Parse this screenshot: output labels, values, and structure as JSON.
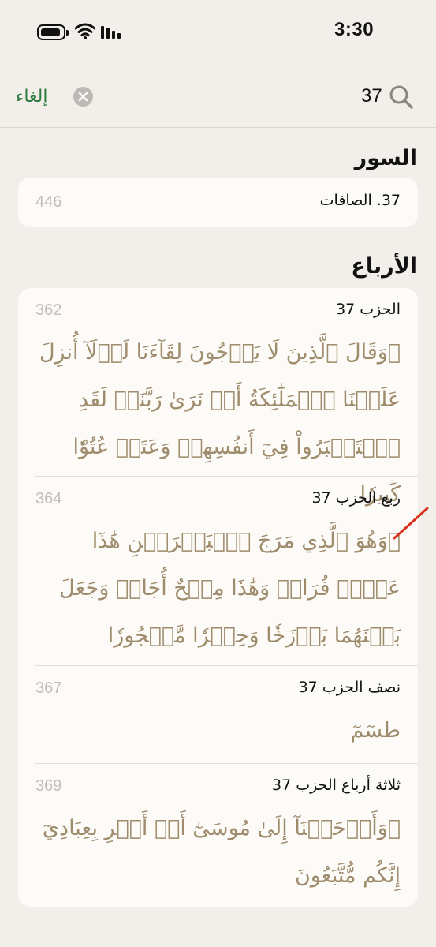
{
  "status_bar": {
    "time": "3:30"
  },
  "search": {
    "value": "37",
    "cancel_label": "إلغاء"
  },
  "sections": {
    "surahs": {
      "title": "السور",
      "items": [
        {
          "label": "37. الصافات",
          "page": "446"
        }
      ]
    },
    "rubs": {
      "title": "الأرباع",
      "items": [
        {
          "label": "الحزب 37",
          "page": "362",
          "verse": "۞وَقَالَ ٱلَّذِينَ لَا يَرۡجُونَ لِقَآءَنَا لَوۡلَآ أُنزِلَ عَلَيۡنَا ٱلۡمَلَٰٓئِكَةُ أَوۡ نَرَىٰ رَبَّنَاۗ لَقَدِ ٱسۡتَكۡبَرُواْ فِيٓ أَنفُسِهِمۡ وَعَتَوۡ عُتُوّٗا كَبِيرٗا"
        },
        {
          "label": "ربع الحزب 37",
          "page": "364",
          "verse": "۞وَهُوَ ٱلَّذِي مَرَجَ ٱلۡبَحۡرَيۡنِ هَٰذَا عَذۡبٞ فُرَاتٞ وَهَٰذَا مِلۡحٌ أُجَاجٞ وَجَعَلَ بَيۡنَهُمَا بَرۡزَخٗا وَحِجۡرٗا مَّحۡجُورٗا"
        },
        {
          "label": "نصف الحزب 37",
          "page": "367",
          "verse": "طسٓمٓ"
        },
        {
          "label": "ثلاثة أرباع الحزب 37",
          "page": "369",
          "verse": "۞وَأَوۡحَيۡنَآ إِلَىٰ مُوسَىٰٓ أَنۡ أَسۡرِ بِعِبَادِيٓ إِنَّكُم مُّتَّبَعُونَ"
        }
      ]
    }
  }
}
